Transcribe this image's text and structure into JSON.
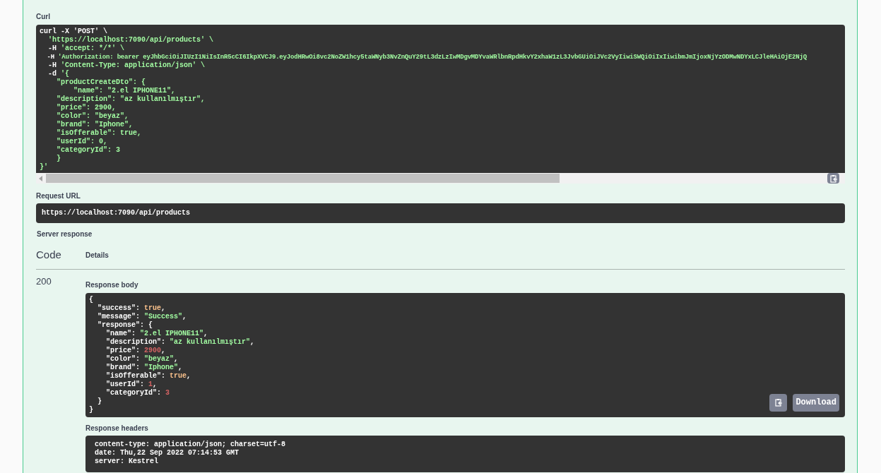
{
  "curl": {
    "label": "Curl",
    "lines": [
      [
        {
          "text": "curl -X 'POST' \\",
          "kind": "plain"
        }
      ],
      [
        {
          "text": "  'https://localhost:7090/api/products' \\",
          "kind": "string"
        }
      ],
      [
        {
          "text": "  -H ",
          "kind": "plain"
        },
        {
          "text": "'accept: */*' \\",
          "kind": "string"
        }
      ],
      [
        {
          "text": "  -H ",
          "kind": "plain"
        },
        {
          "text": "'Authorization: bearer eyJhbGciOiJIUzI1NiIsInR5cCI6IkpXVCJ9.eyJodHRwOi8vc2NoZW1hcy5taWNyb3NvZnQuY29tL3dzLzIwMDgvMDYvaWRlbnRpdHkvY2xhaW1zL3JvbGUiOiJVc2VyIiwiSWQiOiIxIiwibmJmIjoxNjYzODMwNDYxLCJleHAiOjE2NjQ",
          "kind": "string"
        }
      ],
      [
        {
          "text": "  -H ",
          "kind": "plain"
        },
        {
          "text": "'Content-Type: application/json' \\",
          "kind": "string"
        }
      ],
      [
        {
          "text": "  -d ",
          "kind": "plain"
        },
        {
          "text": "'{",
          "kind": "string"
        }
      ],
      [
        {
          "text": "    \"productCreateDto\": {",
          "kind": "string"
        }
      ],
      [
        {
          "text": "        \"name\": \"2.el IPHONE11\",",
          "kind": "string"
        }
      ],
      [
        {
          "text": "    \"description\": \"az kullanılmıştır\",",
          "kind": "string"
        }
      ],
      [
        {
          "text": "    \"price\": 2900,",
          "kind": "string"
        }
      ],
      [
        {
          "text": "    \"color\": \"beyaz\",",
          "kind": "string"
        }
      ],
      [
        {
          "text": "    \"brand\": \"Iphone\",",
          "kind": "string"
        }
      ],
      [
        {
          "text": "    \"isOfferable\": true,",
          "kind": "string"
        }
      ],
      [
        {
          "text": "    \"userId\": 0,",
          "kind": "string"
        }
      ],
      [
        {
          "text": "    \"categoryId\": 3",
          "kind": "string"
        }
      ],
      [
        {
          "text": "    }",
          "kind": "string"
        }
      ],
      [
        {
          "text": "}'",
          "kind": "string"
        }
      ]
    ]
  },
  "request_url": {
    "label": "Request URL",
    "value": "https://localhost:7090/api/products"
  },
  "server_response": {
    "label": "Server response",
    "columns": [
      "Code",
      "Details"
    ],
    "code": "200",
    "body": {
      "label": "Response body",
      "lines": [
        [
          {
            "text": "{",
            "kind": "plain"
          }
        ],
        [
          {
            "text": "  \"success\": ",
            "kind": "plain"
          },
          {
            "text": "true",
            "kind": "literal"
          },
          {
            "text": ",",
            "kind": "plain"
          }
        ],
        [
          {
            "text": "  \"message\": ",
            "kind": "plain"
          },
          {
            "text": "\"Success\"",
            "kind": "string"
          },
          {
            "text": ",",
            "kind": "plain"
          }
        ],
        [
          {
            "text": "  \"response\": {",
            "kind": "plain"
          }
        ],
        [
          {
            "text": "    \"name\": ",
            "kind": "plain"
          },
          {
            "text": "\"2.el IPHONE11\"",
            "kind": "string"
          },
          {
            "text": ",",
            "kind": "plain"
          }
        ],
        [
          {
            "text": "    \"description\": ",
            "kind": "plain"
          },
          {
            "text": "\"az kullanılmıştır\"",
            "kind": "string"
          },
          {
            "text": ",",
            "kind": "plain"
          }
        ],
        [
          {
            "text": "    \"price\": ",
            "kind": "plain"
          },
          {
            "text": "2900",
            "kind": "number"
          },
          {
            "text": ",",
            "kind": "plain"
          }
        ],
        [
          {
            "text": "    \"color\": ",
            "kind": "plain"
          },
          {
            "text": "\"beyaz\"",
            "kind": "string"
          },
          {
            "text": ",",
            "kind": "plain"
          }
        ],
        [
          {
            "text": "    \"brand\": ",
            "kind": "plain"
          },
          {
            "text": "\"Iphone\"",
            "kind": "string"
          },
          {
            "text": ",",
            "kind": "plain"
          }
        ],
        [
          {
            "text": "    \"isOfferable\": ",
            "kind": "plain"
          },
          {
            "text": "true",
            "kind": "literal"
          },
          {
            "text": ",",
            "kind": "plain"
          }
        ],
        [
          {
            "text": "    \"userId\": ",
            "kind": "plain"
          },
          {
            "text": "1",
            "kind": "number"
          },
          {
            "text": ",",
            "kind": "plain"
          }
        ],
        [
          {
            "text": "    \"categoryId\": ",
            "kind": "plain"
          },
          {
            "text": "3",
            "kind": "number"
          }
        ],
        [
          {
            "text": "  }",
            "kind": "plain"
          }
        ],
        [
          {
            "text": "}",
            "kind": "plain"
          }
        ]
      ],
      "download_button": "Download"
    },
    "headers": {
      "label": "Response headers",
      "lines": [
        "content-type: application/json; charset=utf-8",
        "date: Thu,22 Sep 2022 07:14:53 GMT",
        "server: Kestrel"
      ]
    }
  }
}
